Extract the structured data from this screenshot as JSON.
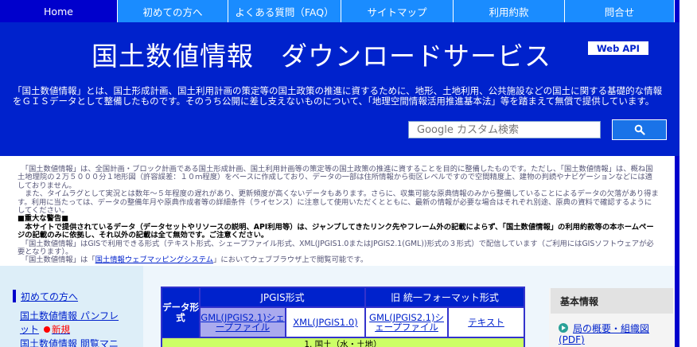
{
  "nav": {
    "items": [
      "Home",
      "初めての方へ",
      "よくある質問（FAQ）",
      "サイトマップ",
      "利用約款",
      "問合せ"
    ]
  },
  "header": {
    "title": "国土数値情報　ダウンロードサービス",
    "webapi_label": "Web API",
    "intro": "「国土数値情報」とは、国土形成計画、国土利用計画の策定等の国土政策の推進に資するために、地形、土地利用、公共施設などの国土に関する基礎的な情報をＧＩＳデータとして整備したものです。そのうち公開に差し支えないものについて、「地理空間情報活用推進基本法」等を踏まえて無償で提供しています。"
  },
  "search": {
    "placeholder": "Google カスタム検索",
    "button_icon": "search-icon"
  },
  "notice": {
    "p1": "　「国土数値情報」は、全国計画・ブロック計画である国土形成計画、国土利用計画等の策定等の国土政策の推進に資することを目的に整備したものです。ただし、「国土数値情報」は、概ね国土地理院の２万５０００分１地形図（許容誤差：１０ｍ程度）をベースに作成しており、データの一部は住所情報から街区レベルですので空間精度上、建物の判読やナビゲーションなどには適しておりません。",
    "p2": "　また、タイムラグとして実況とは数年〜５年程度の遅れがあり、更新頻度が高くないデータもあります。さらに、収集可能な原典情報のみから整備していることによるデータの欠落があり得ます。利用に当たっては、データの整備年月や原典作成者等の詳細条件（ライセンス）に注意して使用いただくとともに、最新の情報が必要な場合はそれぞれ別途、原典の資料で確認するようにしてください。",
    "warn_heading": "■重大な警告■",
    "warn": "　本サイトで提供されているデータ（データセットやリソースの説明、API利用等）は、ジャンプしてきたリンク先やフレーム外の記載によらず、「国土数値情報」の利用約款等の本ホームページの記載のみに依拠し、それ以外の記載は全て無効です。ご注意ください。",
    "p3": "　「国土数値情報」はGISで利用できる形式（テキスト形式、シェープファイル形式、XML(JPGIS1.0またはJPGIS2.1(GML))形式の３形式）で配信しています（ご利用にはGISソフトウェアが必要となります）。",
    "p4_pre": "　「国土数値情報」は「",
    "p4_link": "国土情報ウェブマッピングシステム",
    "p4_post": "」においてウェブブラウザ上で閲覧可能です。"
  },
  "sidebar": {
    "first": "初めての方へ",
    "link1_a": "国土数値情報 パンフレ",
    "link1_b": "ット",
    "new": "新規",
    "link2": "国土数値情報 閲覧マニ"
  },
  "formats": {
    "data_type": "データ形式",
    "group1": "JPGIS形式",
    "group2": "旧 統一フォーマット形式",
    "cols": [
      "GML(JPGIS2.1)シェープファイル",
      "XML(JPGIS1.0)",
      "GML(JPGIS2.1)シェープファイル",
      "テキスト"
    ],
    "row1": "1. 国土（水・土地）"
  },
  "right": {
    "heading": "基本情報",
    "link1": "局の概要・組織図",
    "link2": "(PDF)"
  },
  "colors": {
    "nav": "#1a8cff",
    "nav_active": "#0000cc",
    "header": "#0022cc",
    "band": "#ccff66"
  }
}
